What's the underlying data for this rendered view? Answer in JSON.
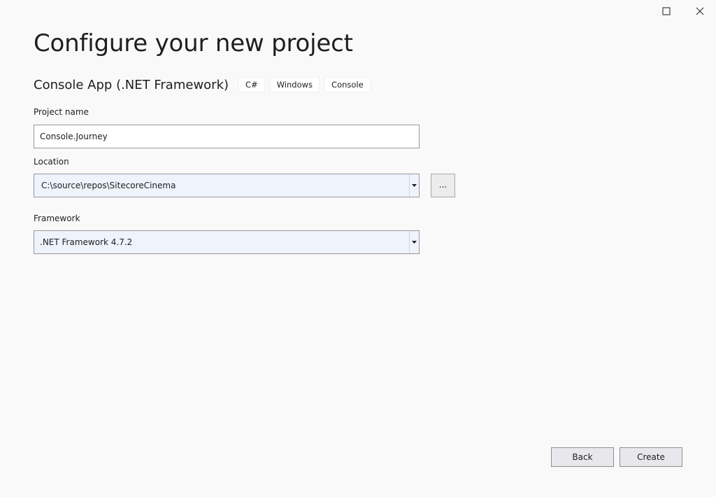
{
  "window": {
    "maximize_icon": "maximize-icon",
    "close_icon": "close-icon"
  },
  "page": {
    "title": "Configure your new project"
  },
  "template": {
    "name": "Console App (.NET Framework)",
    "tags": [
      "C#",
      "Windows",
      "Console"
    ]
  },
  "project_name": {
    "label": "Project name",
    "value": "Console.Journey"
  },
  "location": {
    "label": "Location",
    "value": "C:\\source\\repos\\SitecoreCinema",
    "browse_label": "...",
    "dropdown_icon": "caret-down-icon"
  },
  "framework": {
    "label": "Framework",
    "value": ".NET Framework 4.7.2",
    "dropdown_icon": "caret-down-icon"
  },
  "footer": {
    "back_label": "Back",
    "create_label": "Create"
  },
  "colors": {
    "background": "#f9f9f9",
    "combo_background": "#eef3fc",
    "input_border": "#999999",
    "button_background": "#e8e8ec"
  }
}
